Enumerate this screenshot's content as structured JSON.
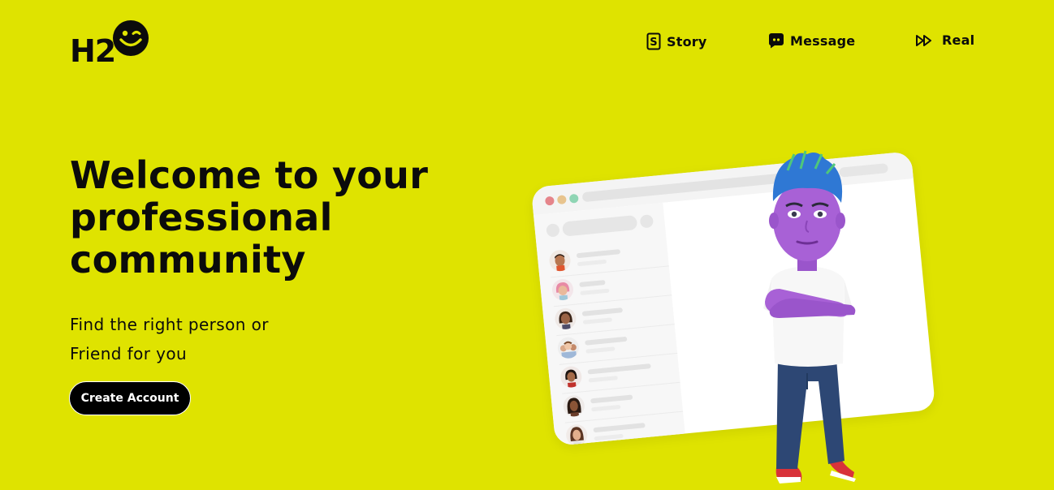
{
  "brand": {
    "logo_text": "H2",
    "logo_icon": "wink-face-icon"
  },
  "nav": {
    "items": [
      {
        "label": "Story",
        "icon": "story-s-icon"
      },
      {
        "label": "Message",
        "icon": "chat-bubble-icon"
      },
      {
        "label": "Real",
        "icon": "fast-forward-icon"
      }
    ]
  },
  "hero": {
    "title_lines": [
      "Welcome to your",
      "professional",
      "community"
    ],
    "subtitle_lines": [
      "Find the right person or",
      "Friend for you"
    ],
    "cta_label": "Create Account"
  },
  "illustration": {
    "contacts": [
      {
        "avatar": "bitmoji-man-avatar"
      },
      {
        "avatar": "bitmoji-pink-hair-avatar"
      },
      {
        "avatar": "bitmoji-woman-avatar"
      },
      {
        "avatar": "bitmoji-group-avatar"
      },
      {
        "avatar": "bitmoji-woman-red-avatar"
      },
      {
        "avatar": "bitmoji-woman-dark-hair-avatar"
      },
      {
        "avatar": "bitmoji-woman-brown-hair-avatar"
      }
    ],
    "character": "purple-bitmoji-character"
  },
  "colors": {
    "background": "#dfe300",
    "text": "#0b0b0b",
    "button_bg": "#000000",
    "button_text": "#ffffff"
  }
}
